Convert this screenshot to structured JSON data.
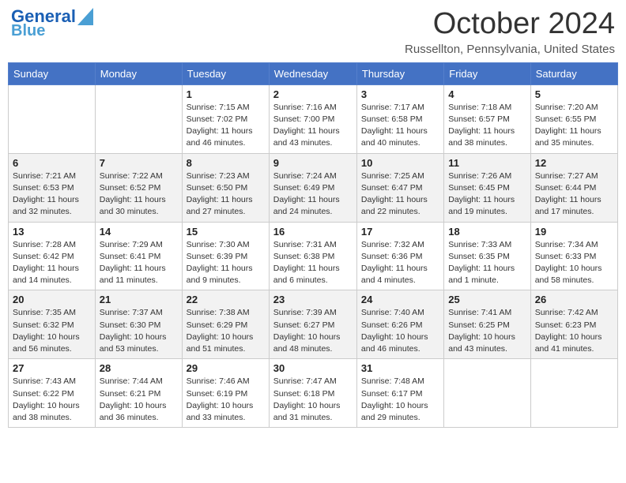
{
  "header": {
    "logo_general": "General",
    "logo_blue": "Blue",
    "month_title": "October 2024",
    "location": "Russellton, Pennsylvania, United States"
  },
  "weekdays": [
    "Sunday",
    "Monday",
    "Tuesday",
    "Wednesday",
    "Thursday",
    "Friday",
    "Saturday"
  ],
  "weeks": [
    [
      {
        "day": "",
        "info": ""
      },
      {
        "day": "",
        "info": ""
      },
      {
        "day": "1",
        "info": "Sunrise: 7:15 AM\nSunset: 7:02 PM\nDaylight: 11 hours and 46 minutes."
      },
      {
        "day": "2",
        "info": "Sunrise: 7:16 AM\nSunset: 7:00 PM\nDaylight: 11 hours and 43 minutes."
      },
      {
        "day": "3",
        "info": "Sunrise: 7:17 AM\nSunset: 6:58 PM\nDaylight: 11 hours and 40 minutes."
      },
      {
        "day": "4",
        "info": "Sunrise: 7:18 AM\nSunset: 6:57 PM\nDaylight: 11 hours and 38 minutes."
      },
      {
        "day": "5",
        "info": "Sunrise: 7:20 AM\nSunset: 6:55 PM\nDaylight: 11 hours and 35 minutes."
      }
    ],
    [
      {
        "day": "6",
        "info": "Sunrise: 7:21 AM\nSunset: 6:53 PM\nDaylight: 11 hours and 32 minutes."
      },
      {
        "day": "7",
        "info": "Sunrise: 7:22 AM\nSunset: 6:52 PM\nDaylight: 11 hours and 30 minutes."
      },
      {
        "day": "8",
        "info": "Sunrise: 7:23 AM\nSunset: 6:50 PM\nDaylight: 11 hours and 27 minutes."
      },
      {
        "day": "9",
        "info": "Sunrise: 7:24 AM\nSunset: 6:49 PM\nDaylight: 11 hours and 24 minutes."
      },
      {
        "day": "10",
        "info": "Sunrise: 7:25 AM\nSunset: 6:47 PM\nDaylight: 11 hours and 22 minutes."
      },
      {
        "day": "11",
        "info": "Sunrise: 7:26 AM\nSunset: 6:45 PM\nDaylight: 11 hours and 19 minutes."
      },
      {
        "day": "12",
        "info": "Sunrise: 7:27 AM\nSunset: 6:44 PM\nDaylight: 11 hours and 17 minutes."
      }
    ],
    [
      {
        "day": "13",
        "info": "Sunrise: 7:28 AM\nSunset: 6:42 PM\nDaylight: 11 hours and 14 minutes."
      },
      {
        "day": "14",
        "info": "Sunrise: 7:29 AM\nSunset: 6:41 PM\nDaylight: 11 hours and 11 minutes."
      },
      {
        "day": "15",
        "info": "Sunrise: 7:30 AM\nSunset: 6:39 PM\nDaylight: 11 hours and 9 minutes."
      },
      {
        "day": "16",
        "info": "Sunrise: 7:31 AM\nSunset: 6:38 PM\nDaylight: 11 hours and 6 minutes."
      },
      {
        "day": "17",
        "info": "Sunrise: 7:32 AM\nSunset: 6:36 PM\nDaylight: 11 hours and 4 minutes."
      },
      {
        "day": "18",
        "info": "Sunrise: 7:33 AM\nSunset: 6:35 PM\nDaylight: 11 hours and 1 minute."
      },
      {
        "day": "19",
        "info": "Sunrise: 7:34 AM\nSunset: 6:33 PM\nDaylight: 10 hours and 58 minutes."
      }
    ],
    [
      {
        "day": "20",
        "info": "Sunrise: 7:35 AM\nSunset: 6:32 PM\nDaylight: 10 hours and 56 minutes."
      },
      {
        "day": "21",
        "info": "Sunrise: 7:37 AM\nSunset: 6:30 PM\nDaylight: 10 hours and 53 minutes."
      },
      {
        "day": "22",
        "info": "Sunrise: 7:38 AM\nSunset: 6:29 PM\nDaylight: 10 hours and 51 minutes."
      },
      {
        "day": "23",
        "info": "Sunrise: 7:39 AM\nSunset: 6:27 PM\nDaylight: 10 hours and 48 minutes."
      },
      {
        "day": "24",
        "info": "Sunrise: 7:40 AM\nSunset: 6:26 PM\nDaylight: 10 hours and 46 minutes."
      },
      {
        "day": "25",
        "info": "Sunrise: 7:41 AM\nSunset: 6:25 PM\nDaylight: 10 hours and 43 minutes."
      },
      {
        "day": "26",
        "info": "Sunrise: 7:42 AM\nSunset: 6:23 PM\nDaylight: 10 hours and 41 minutes."
      }
    ],
    [
      {
        "day": "27",
        "info": "Sunrise: 7:43 AM\nSunset: 6:22 PM\nDaylight: 10 hours and 38 minutes."
      },
      {
        "day": "28",
        "info": "Sunrise: 7:44 AM\nSunset: 6:21 PM\nDaylight: 10 hours and 36 minutes."
      },
      {
        "day": "29",
        "info": "Sunrise: 7:46 AM\nSunset: 6:19 PM\nDaylight: 10 hours and 33 minutes."
      },
      {
        "day": "30",
        "info": "Sunrise: 7:47 AM\nSunset: 6:18 PM\nDaylight: 10 hours and 31 minutes."
      },
      {
        "day": "31",
        "info": "Sunrise: 7:48 AM\nSunset: 6:17 PM\nDaylight: 10 hours and 29 minutes."
      },
      {
        "day": "",
        "info": ""
      },
      {
        "day": "",
        "info": ""
      }
    ]
  ]
}
